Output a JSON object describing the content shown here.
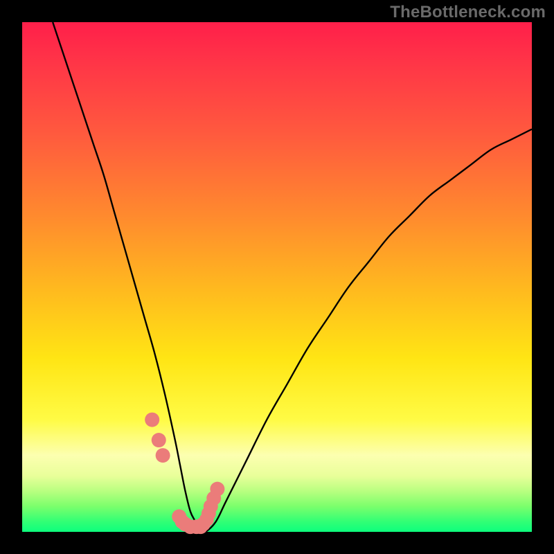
{
  "watermark": "TheBottleneck.com",
  "chart_data": {
    "type": "line",
    "title": "",
    "xlabel": "",
    "ylabel": "",
    "xlim": [
      0,
      100
    ],
    "ylim": [
      0,
      100
    ],
    "x": [
      6,
      8,
      10,
      12,
      14,
      16,
      18,
      20,
      22,
      24,
      26,
      28,
      30,
      31,
      32,
      33,
      34,
      35,
      36,
      38,
      40,
      44,
      48,
      52,
      56,
      60,
      64,
      68,
      72,
      76,
      80,
      84,
      88,
      92,
      96,
      100
    ],
    "values": [
      100,
      94,
      88,
      82,
      76,
      70,
      63,
      56,
      49,
      42,
      35,
      27,
      18,
      13,
      8,
      4,
      2,
      0,
      0,
      2,
      6,
      14,
      22,
      29,
      36,
      42,
      48,
      53,
      58,
      62,
      66,
      69,
      72,
      75,
      77,
      79
    ],
    "markers": {
      "x": [
        25.5,
        26.8,
        27.6,
        30.8,
        31.4,
        32.0,
        33.0,
        34.2,
        35.0,
        35.5,
        36.2,
        36.6,
        37.0,
        37.6,
        38.3
      ],
      "y": [
        22,
        18,
        15,
        3,
        2,
        1.5,
        1,
        1,
        1,
        1.5,
        2.4,
        3.6,
        5.0,
        6.6,
        8.4
      ]
    },
    "gradient_stops": [
      {
        "pos": 0,
        "color": "#ff1f4a"
      },
      {
        "pos": 22,
        "color": "#ff5a3e"
      },
      {
        "pos": 52,
        "color": "#ffb81f"
      },
      {
        "pos": 78,
        "color": "#fffb45"
      },
      {
        "pos": 95,
        "color": "#7bff6c"
      },
      {
        "pos": 100,
        "color": "#0dff7d"
      }
    ],
    "marker_color": "#eb7c7a",
    "curve_color": "#000000"
  }
}
